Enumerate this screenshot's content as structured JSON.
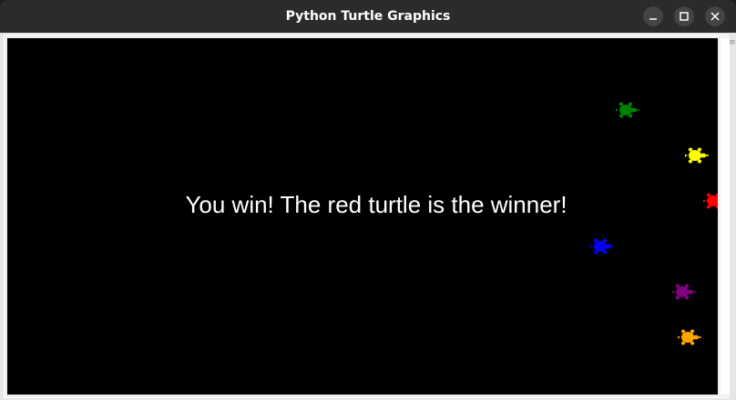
{
  "window": {
    "title": "Python Turtle Graphics",
    "buttons": {
      "minimize": "minimize",
      "maximize": "maximize",
      "close": "close"
    }
  },
  "canvas": {
    "background": "#000000",
    "message": "You win! The red turtle is the winner!",
    "message_color": "#ffffff"
  },
  "turtles": [
    {
      "color": "#008000",
      "name": "green"
    },
    {
      "color": "#ffff00",
      "name": "yellow"
    },
    {
      "color": "#ff0000",
      "name": "red"
    },
    {
      "color": "#0000ff",
      "name": "blue"
    },
    {
      "color": "#800080",
      "name": "purple"
    },
    {
      "color": "#ffa500",
      "name": "orange"
    }
  ]
}
